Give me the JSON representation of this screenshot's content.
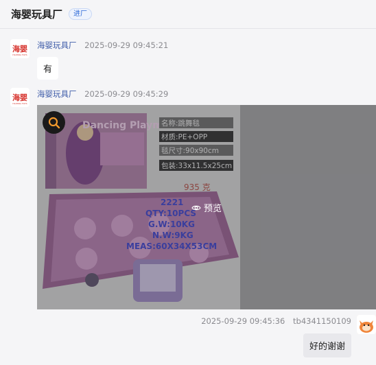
{
  "header": {
    "title": "海婴玩具厂",
    "tag": "进厂"
  },
  "shop_logo": {
    "text": "海婴",
    "sub": "HAIYING TOYS"
  },
  "messages": [
    {
      "sender": "海婴玩具厂",
      "time": "2025-09-29 09:45:21",
      "text": "有"
    },
    {
      "sender": "海婴玩具厂",
      "time": "2025-09-29 09:45:29"
    },
    {
      "sender": "tb4341150109",
      "time": "2025-09-29 09:45:36",
      "text": "好的谢谢"
    }
  ],
  "product_image": {
    "box_title": "Dancing Playmat",
    "specs": [
      "名称:跳舞毯",
      "材质:PE+OPP",
      "毯尺寸:90x90cm",
      "包装:33x11.5x25cm"
    ],
    "weight": "935 克",
    "carton_info": [
      "2221",
      "QTY:10PCS",
      "G.W:10KG",
      "N.W:9KG",
      "MEAS:60X34X53CM"
    ]
  },
  "preview_label": "预览",
  "colors": {
    "sender": "#3d5ba8",
    "tag": "#2f6bd8",
    "logo": "#d6312b",
    "spec_red": "#c8453a",
    "carton_text": "#3a3fd0"
  }
}
